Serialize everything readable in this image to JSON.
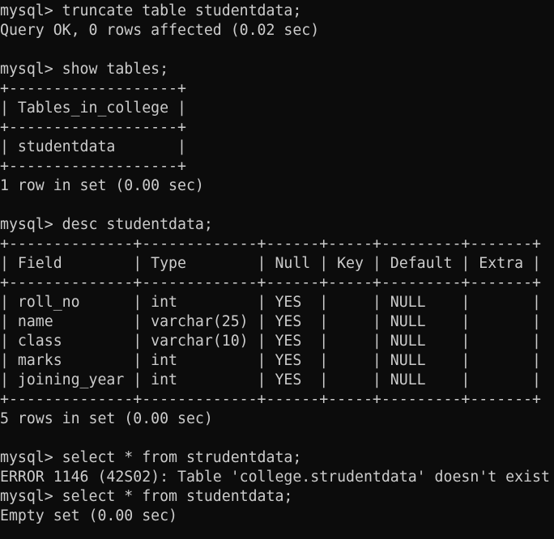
{
  "terminal": {
    "lines": [
      "mysql> truncate table studentdata;",
      "Query OK, 0 rows affected (0.02 sec)",
      "",
      "mysql> show tables;",
      "+-------------------+",
      "| Tables_in_college |",
      "+-------------------+",
      "| studentdata       |",
      "+-------------------+",
      "1 row in set (0.00 sec)",
      "",
      "mysql> desc studentdata;",
      "+--------------+-------------+------+-----+---------+-------+",
      "| Field        | Type        | Null | Key | Default | Extra |",
      "+--------------+-------------+------+-----+---------+-------+",
      "| roll_no      | int         | YES  |     | NULL    |       |",
      "| name         | varchar(25) | YES  |     | NULL    |       |",
      "| class        | varchar(10) | YES  |     | NULL    |       |",
      "| marks        | int         | YES  |     | NULL    |       |",
      "| joining_year | int         | YES  |     | NULL    |       |",
      "+--------------+-------------+------+-----+---------+-------+",
      "5 rows in set (0.00 sec)",
      "",
      "mysql> select * from strudentdata;",
      "ERROR 1146 (42S02): Table 'college.strudentdata' doesn't exist",
      "mysql> select * from studentdata;",
      "Empty set (0.00 sec)"
    ]
  }
}
